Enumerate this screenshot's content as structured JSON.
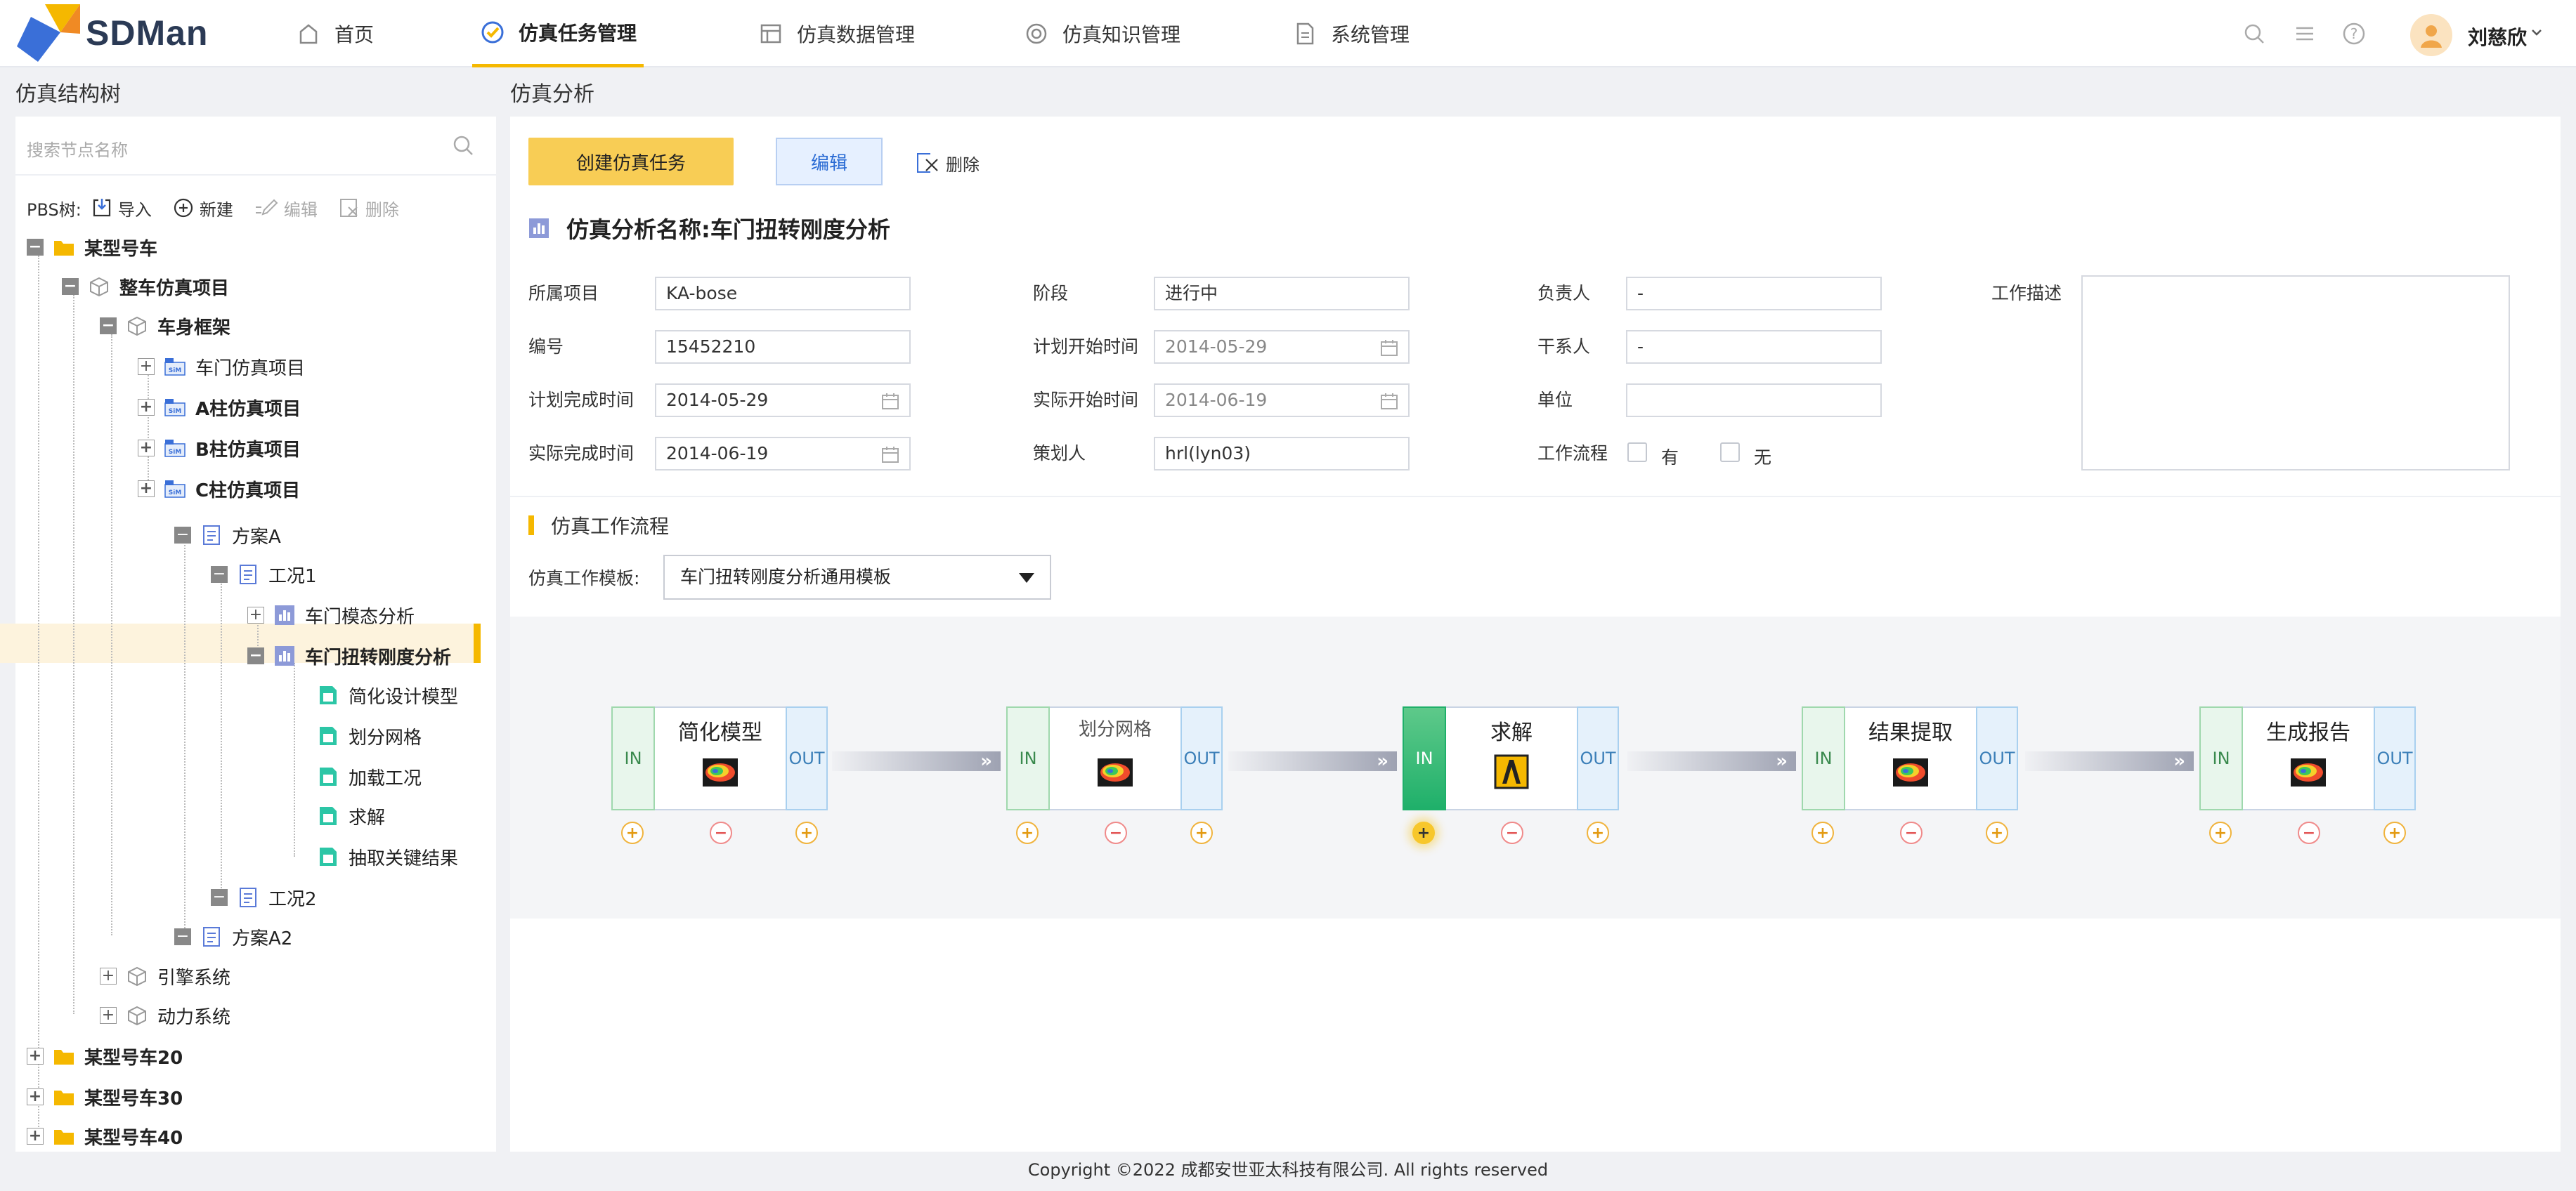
{
  "app": {
    "brand": "SDMan"
  },
  "nav": [
    {
      "label": "首页",
      "icon": "home-icon"
    },
    {
      "label": "仿真任务管理",
      "icon": "task-icon",
      "active": true
    },
    {
      "label": "仿真数据管理",
      "icon": "data-icon"
    },
    {
      "label": "仿真知识管理",
      "icon": "knowledge-icon"
    },
    {
      "label": "系统管理",
      "icon": "system-icon"
    }
  ],
  "user": {
    "name": "刘慈欣"
  },
  "left": {
    "title": "仿真结构树",
    "search_placeholder": "搜索节点名称",
    "pbs_label": "PBS树:",
    "toolbar": {
      "import": "导入",
      "new": "新建",
      "edit": "编辑",
      "delete": "删除"
    },
    "tree": [
      {
        "label": "某型号车"
      },
      {
        "label": "整车仿真项目"
      },
      {
        "label": "车身框架"
      },
      {
        "label": "车门仿真项目"
      },
      {
        "label": "A柱仿真项目"
      },
      {
        "label": "B柱仿真项目"
      },
      {
        "label": "C柱仿真项目"
      },
      {
        "label": "方案A"
      },
      {
        "label": "工况1"
      },
      {
        "label": "车门模态分析"
      },
      {
        "label": "车门扭转刚度分析",
        "selected": true
      },
      {
        "label": "简化设计模型"
      },
      {
        "label": "划分网格"
      },
      {
        "label": "加载工况"
      },
      {
        "label": "求解"
      },
      {
        "label": "抽取关键结果"
      },
      {
        "label": "工况2"
      },
      {
        "label": "方案A2"
      },
      {
        "label": "引擎系统"
      },
      {
        "label": "动力系统"
      },
      {
        "label": "某型号车20"
      },
      {
        "label": "某型号车30"
      },
      {
        "label": "某型号车40"
      }
    ]
  },
  "right": {
    "title": "仿真分析",
    "buttons": {
      "create": "创建仿真任务",
      "edit": "编辑",
      "delete": "删除"
    },
    "analysis_label": "仿真分析名称:",
    "analysis_name": "车门扭转刚度分析",
    "form": {
      "project_label": "所属项目",
      "project": "KA-bose",
      "stage_label": "阶段",
      "stage": "进行中",
      "owner_label": "负责人",
      "owner": "-",
      "desc_label": "工作描述",
      "code_label": "编号",
      "code": "15452210",
      "plan_start_label": "计划开始时间",
      "plan_start": "2014-05-29",
      "contact_label": "干系人",
      "contact": "-",
      "plan_end_label": "计划完成时间",
      "plan_end": "2014-05-29",
      "actual_start_label": "实际开始时间",
      "actual_start": "2014-06-19",
      "unit_label": "单位",
      "unit": "",
      "actual_end_label": "实际完成时间",
      "actual_end": "2014-06-19",
      "planner_label": "策划人",
      "planner": "hrl(lyn03)",
      "workflow_label": "工作流程",
      "workflow_yes": "有",
      "workflow_no": "无"
    },
    "workflow": {
      "title": "仿真工作流程",
      "template_label": "仿真工作模板:",
      "template": "车门扭转刚度分析通用模板",
      "nodes": [
        {
          "name": "简化模型",
          "in": "IN",
          "out": "OUT"
        },
        {
          "name": "划分网格",
          "in": "IN",
          "out": "OUT"
        },
        {
          "name": "求解",
          "in": "IN",
          "out": "OUT",
          "active": true
        },
        {
          "name": "结果提取",
          "in": "IN",
          "out": "OUT"
        },
        {
          "name": "生成报告",
          "in": "IN",
          "out": "OUT"
        }
      ]
    }
  },
  "footer": "Copyright ©2022 成都安世亚太科技有限公司. All rights reserved",
  "colors": {
    "accent": "#f5b800",
    "primary_button": "#f8cd55",
    "edit_button": "#2a6bd4"
  }
}
